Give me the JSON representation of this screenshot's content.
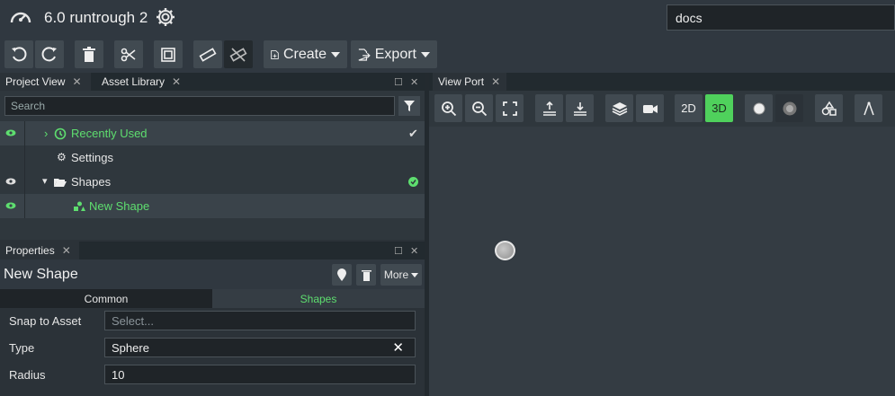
{
  "app": {
    "title": "6.0 runtrough 2",
    "search_value": "docs"
  },
  "toolbar": {
    "create_label": "Create",
    "export_label": "Export"
  },
  "project_panel": {
    "tabs": [
      {
        "label": "Project View"
      },
      {
        "label": "Asset Library"
      }
    ],
    "search_placeholder": "Search",
    "items": [
      {
        "label": "Recently Used"
      },
      {
        "label": "Settings"
      },
      {
        "label": "Shapes"
      },
      {
        "label": "New Shape"
      }
    ]
  },
  "properties": {
    "tab_label": "Properties",
    "title": "New Shape",
    "more_label": "More",
    "subtabs": [
      {
        "label": "Common"
      },
      {
        "label": "Shapes"
      }
    ],
    "fields": [
      {
        "label": "Snap to Asset",
        "placeholder": "Select..."
      },
      {
        "label": "Type",
        "value": "Sphere"
      },
      {
        "label": "Radius",
        "value": "10"
      }
    ]
  },
  "viewport": {
    "tab_label": "View Port",
    "mode_2d": "2D",
    "mode_3d": "3D",
    "active_mode": "3D"
  },
  "colors": {
    "accent_green": "#5ede6f",
    "active_3d": "#4fd15c"
  },
  "icons": [
    "gauge-icon",
    "gear-icon",
    "undo-icon",
    "redo-icon",
    "trash-icon",
    "scissors-icon",
    "frame-icon",
    "ruler-icon",
    "ruler-off-icon",
    "file-plus-icon",
    "export-icon",
    "zoom-in-icon",
    "zoom-out-icon",
    "fullscreen-icon",
    "upload-icon",
    "download-icon",
    "layers-icon",
    "camera-icon",
    "circle-icon",
    "texture-icon",
    "shapes-icon",
    "compass-icon"
  ]
}
